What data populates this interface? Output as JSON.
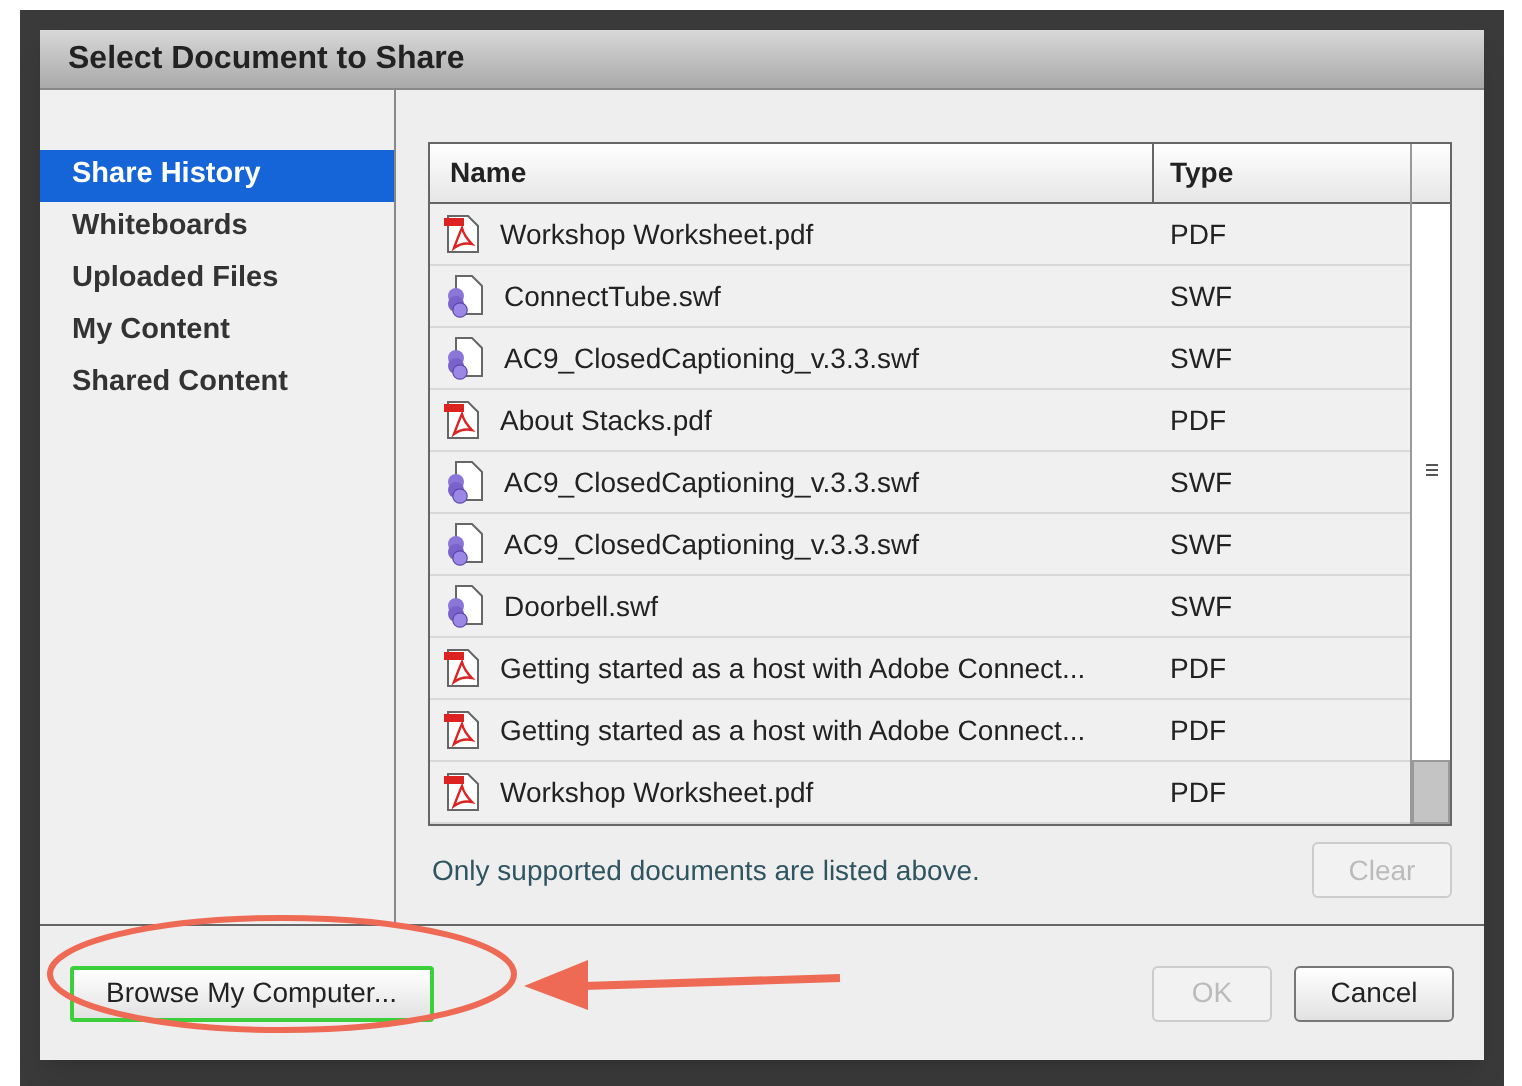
{
  "window": {
    "title": "Select Document to Share"
  },
  "sidebar": {
    "items": [
      {
        "label": "Share History",
        "selected": true
      },
      {
        "label": "Whiteboards",
        "selected": false
      },
      {
        "label": "Uploaded Files",
        "selected": false
      },
      {
        "label": "My Content",
        "selected": false
      },
      {
        "label": "Shared Content",
        "selected": false
      }
    ]
  },
  "table": {
    "columns": [
      "Name",
      "Type"
    ],
    "rows": [
      {
        "kind": "pdf",
        "name": "Workshop Worksheet.pdf",
        "type": "PDF"
      },
      {
        "kind": "swf",
        "name": "ConnectTube.swf",
        "type": "SWF"
      },
      {
        "kind": "swf",
        "name": "AC9_ClosedCaptioning_v.3.3.swf",
        "type": "SWF"
      },
      {
        "kind": "pdf",
        "name": "About Stacks.pdf",
        "type": "PDF"
      },
      {
        "kind": "swf",
        "name": "AC9_ClosedCaptioning_v.3.3.swf",
        "type": "SWF"
      },
      {
        "kind": "swf",
        "name": "AC9_ClosedCaptioning_v.3.3.swf",
        "type": "SWF"
      },
      {
        "kind": "swf",
        "name": "Doorbell.swf",
        "type": "SWF"
      },
      {
        "kind": "pdf",
        "name": "Getting started as a host with Adobe Connect...",
        "type": "PDF"
      },
      {
        "kind": "pdf",
        "name": "Getting started as a host with Adobe Connect...",
        "type": "PDF"
      },
      {
        "kind": "pdf",
        "name": "Workshop Worksheet.pdf",
        "type": "PDF"
      }
    ]
  },
  "note": "Only supported documents are listed above.",
  "clear_button": {
    "label": "Clear",
    "disabled": true
  },
  "browse_button": {
    "label": "Browse My Computer...",
    "focused": true
  },
  "ok_button": {
    "label": "OK",
    "disabled": true
  },
  "cancel_button": {
    "label": "Cancel",
    "disabled": false
  }
}
